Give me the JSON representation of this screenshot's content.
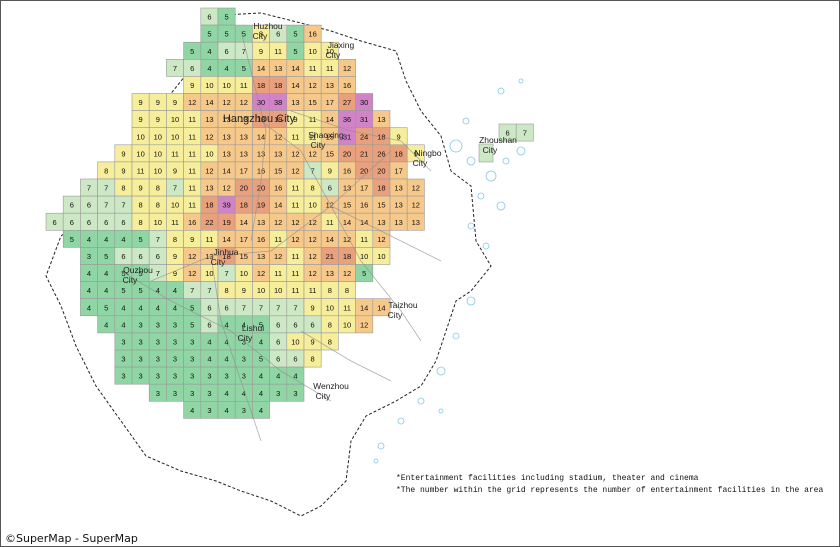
{
  "map": {
    "cities": [
      {
        "name": "Huzhou",
        "line2": "City"
      },
      {
        "name": "Jiaxing",
        "line2": "City"
      },
      {
        "name": "Hangzhou City",
        "line2": ""
      },
      {
        "name": "Shaoxing",
        "line2": "City"
      },
      {
        "name": "Ningbo",
        "line2": "City"
      },
      {
        "name": "Zhoushan",
        "line2": "City"
      },
      {
        "name": "Jinhua",
        "line2": "City"
      },
      {
        "name": "Quzhou",
        "line2": "City"
      },
      {
        "name": "Taizhou",
        "line2": "City"
      },
      {
        "name": "Lishui",
        "line2": "City"
      },
      {
        "name": "Wenzhou",
        "line2": "City"
      }
    ],
    "grid_rows": [
      {
        "y": 1,
        "start": 10,
        "values": [
          6,
          5
        ]
      },
      {
        "y": 2,
        "start": 10,
        "values": [
          5,
          5,
          5,
          8,
          6,
          5,
          16
        ]
      },
      {
        "y": 3,
        "start": 9,
        "values": [
          5,
          4,
          6,
          7,
          9,
          11,
          5,
          10,
          10
        ]
      },
      {
        "y": 4,
        "start": 8,
        "values": [
          7,
          6,
          4,
          4,
          5,
          14,
          13,
          14,
          11,
          11,
          12
        ]
      },
      {
        "y": 5,
        "start": 9,
        "values": [
          9,
          10,
          10,
          11,
          18,
          18,
          14,
          12,
          13,
          16
        ]
      },
      {
        "y": 6,
        "start": 6,
        "values": [
          9,
          9,
          9,
          12,
          14,
          12,
          12,
          30,
          38,
          13,
          15,
          17,
          27,
          30
        ]
      },
      {
        "y": 7,
        "start": 6,
        "values": [
          9,
          9,
          10,
          11,
          13,
          13,
          13,
          18,
          19,
          9,
          11,
          14,
          36,
          31,
          13
        ]
      },
      {
        "y": 8,
        "start": 6,
        "values": [
          10,
          10,
          10,
          11,
          12,
          13,
          13,
          14,
          12,
          11,
          11,
          15,
          31,
          24,
          18,
          9
        ]
      },
      {
        "y": 9,
        "start": 5,
        "values": [
          9,
          10,
          10,
          11,
          11,
          10,
          13,
          13,
          13,
          13,
          12,
          12,
          15,
          20,
          21,
          26,
          18,
          9
        ]
      },
      {
        "y": 10,
        "start": 4,
        "values": [
          8,
          9,
          11,
          10,
          9,
          11,
          12,
          14,
          17,
          16,
          15,
          12,
          7,
          9,
          16,
          20,
          20,
          17
        ]
      },
      {
        "y": 11,
        "start": 3,
        "values": [
          7,
          7,
          8,
          9,
          8,
          7,
          11,
          13,
          12,
          20,
          20,
          16,
          11,
          8,
          6,
          13,
          17,
          18,
          13,
          12
        ]
      },
      {
        "y": 12,
        "start": 2,
        "values": [
          6,
          6,
          7,
          7,
          8,
          8,
          10,
          11,
          18,
          39,
          18,
          19,
          14,
          11,
          10,
          12,
          15,
          16,
          15,
          13,
          12
        ]
      },
      {
        "y": 13,
        "start": 1,
        "values": [
          6,
          6,
          6,
          6,
          6,
          8,
          10,
          11,
          16,
          22,
          19,
          14,
          13,
          12,
          12,
          12,
          11,
          14,
          14,
          13,
          13,
          13
        ]
      },
      {
        "y": 14,
        "start": 2,
        "values": [
          5,
          4,
          4,
          4,
          5,
          7,
          8,
          9,
          11,
          14,
          17,
          16,
          11,
          12,
          12,
          14,
          12,
          11,
          12
        ]
      },
      {
        "y": 15,
        "start": 3,
        "values": [
          3,
          5,
          6,
          6,
          6,
          9,
          12,
          13,
          18,
          15,
          13,
          12,
          11,
          12,
          21,
          18,
          10,
          10
        ]
      },
      {
        "y": 16,
        "start": 3,
        "values": [
          4,
          4,
          5,
          5,
          7,
          9,
          12,
          10,
          7,
          10,
          12,
          11,
          11,
          12,
          13,
          12,
          5
        ]
      },
      {
        "y": 17,
        "start": 3,
        "values": [
          4,
          4,
          5,
          5,
          4,
          4,
          7,
          7,
          8,
          9,
          10,
          10,
          11,
          11,
          8,
          8
        ]
      },
      {
        "y": 18,
        "start": 3,
        "values": [
          4,
          5,
          4,
          4,
          4,
          4,
          5,
          6,
          6,
          7,
          7,
          7,
          7,
          9,
          10,
          11,
          14,
          14
        ]
      },
      {
        "y": 19,
        "start": 4,
        "values": [
          4,
          4,
          3,
          3,
          3,
          5,
          6,
          4,
          4,
          5,
          6,
          6,
          6,
          8,
          10,
          12
        ]
      },
      {
        "y": 20,
        "start": 5,
        "values": [
          3,
          3,
          3,
          3,
          3,
          4,
          4,
          3,
          4,
          6,
          10,
          9,
          8
        ]
      },
      {
        "y": 21,
        "start": 5,
        "values": [
          3,
          3,
          3,
          3,
          3,
          4,
          4,
          3,
          5,
          6,
          6,
          8
        ]
      },
      {
        "y": 22,
        "start": 5,
        "values": [
          3,
          3,
          3,
          3,
          3,
          3,
          3,
          3,
          4,
          4,
          4
        ]
      },
      {
        "y": 23,
        "start": 7,
        "values": [
          3,
          3,
          3,
          3,
          4,
          4,
          4,
          3,
          3
        ]
      },
      {
        "y": 24,
        "start": 9,
        "values": [
          4,
          3,
          4,
          3,
          4
        ]
      }
    ],
    "zhoushan_cells": [
      6,
      7
    ]
  },
  "notes": {
    "line1": "*Entertainment facilities including stadium, theater and cinema",
    "line2": "*The number within the grid represents the number of entertainment facilities in the area"
  },
  "credit": "©SuperMap - SuperMap",
  "colors": {
    "green": "#8fd6a4",
    "lightgreen": "#cde8c4",
    "yellow": "#f6ee9a",
    "orange": "#f6c98a",
    "deeporange": "#e9a07c",
    "magenta": "#d083c6",
    "grid_line": "#9a9a9a",
    "coast": "#7fc9e6"
  }
}
